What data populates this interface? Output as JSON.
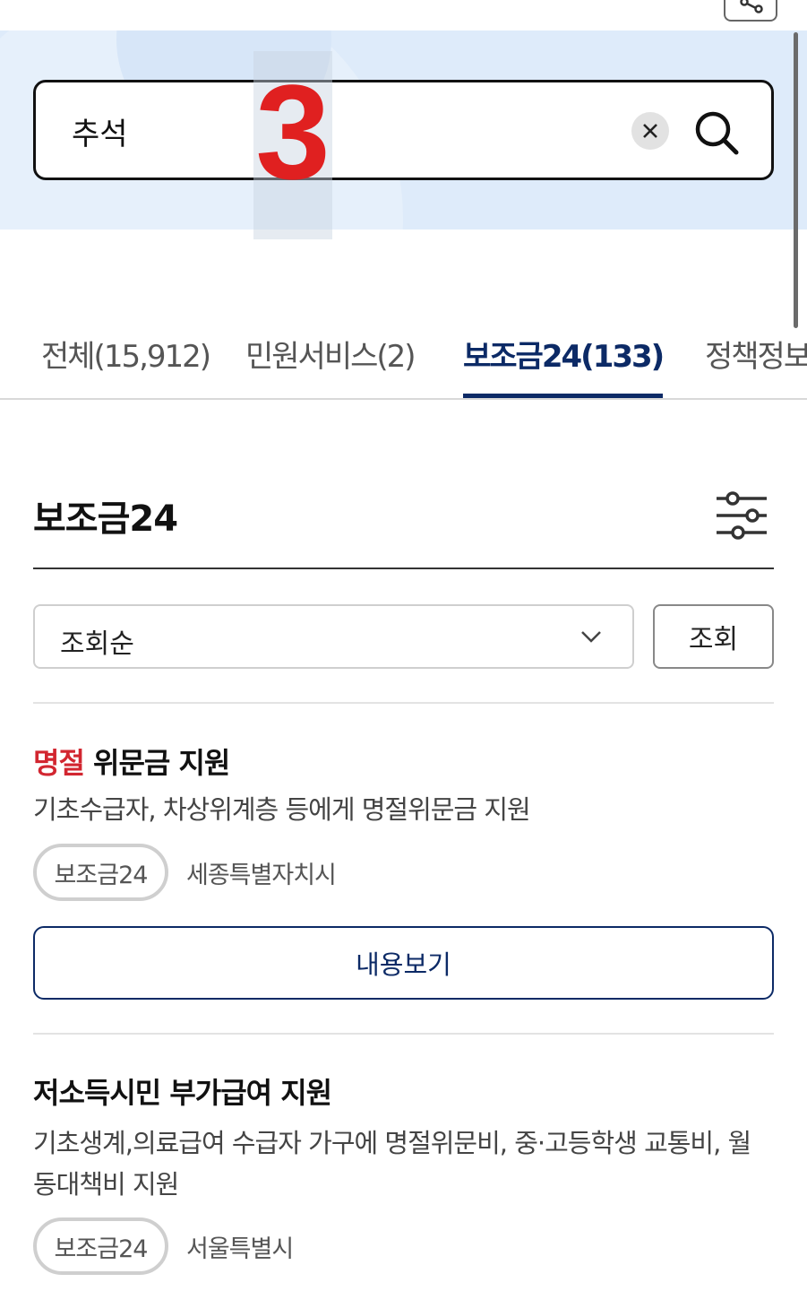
{
  "colors": {
    "primary": "#0c2a66",
    "highlight": "#d22630",
    "hero_bg": "#deebfa",
    "step_marker": "#e02020"
  },
  "header": {
    "share_icon": "share-icon"
  },
  "search": {
    "query": "추석",
    "clear_icon": "close-icon",
    "search_icon": "search-icon"
  },
  "overlay": {
    "step_number": "3"
  },
  "tabs": [
    {
      "label": "전체(15,912)",
      "active": false
    },
    {
      "label": "민원서비스(2)",
      "active": false
    },
    {
      "label": "보조금24(133)",
      "active": true
    },
    {
      "label": "정책정보",
      "active": false
    }
  ],
  "section": {
    "title": "보조금24",
    "filter_icon": "filter-sliders-icon"
  },
  "sort": {
    "selected": "조회순",
    "query_button": "조회"
  },
  "results": [
    {
      "title_highlight": "명절",
      "title_rest": " 위문금 지원",
      "description": "기초수급자, 차상위계층 등에게 명절위문금 지원",
      "chip": "보조금24",
      "region": "세종특별자치시",
      "button": "내용보기"
    },
    {
      "title_highlight": "",
      "title_rest": "저소득시민 부가급여 지원",
      "description": "기초생계,의료급여 수급자 가구에 명절위문비, 중·고등학생 교통비, 월동대책비 지원",
      "chip": "보조금24",
      "region": "서울특별시"
    }
  ]
}
